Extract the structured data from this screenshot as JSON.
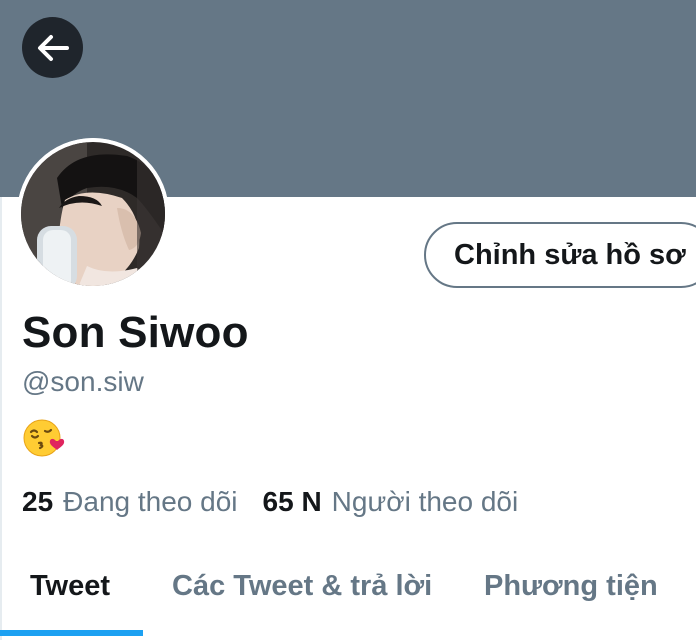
{
  "colors": {
    "banner": "#657786",
    "text_primary": "#14171a",
    "text_secondary": "#657786",
    "accent": "#1da1f2"
  },
  "header": {
    "back_icon": "arrow-left-icon"
  },
  "profile": {
    "edit_button_label": "Chỉnh sửa hồ sơ",
    "display_name": "Son Siwoo",
    "handle": "@son.siw",
    "bio_emoji": "kissing-face-with-heart-emoji"
  },
  "stats": {
    "following_count": "25",
    "following_label": "Đang theo dõi",
    "followers_count": "65 N",
    "followers_label": "Người theo dõi"
  },
  "tabs": [
    {
      "label": "Tweet",
      "active": true
    },
    {
      "label": "Các Tweet & trả lời",
      "active": false
    },
    {
      "label": "Phương tiện",
      "active": false
    }
  ]
}
